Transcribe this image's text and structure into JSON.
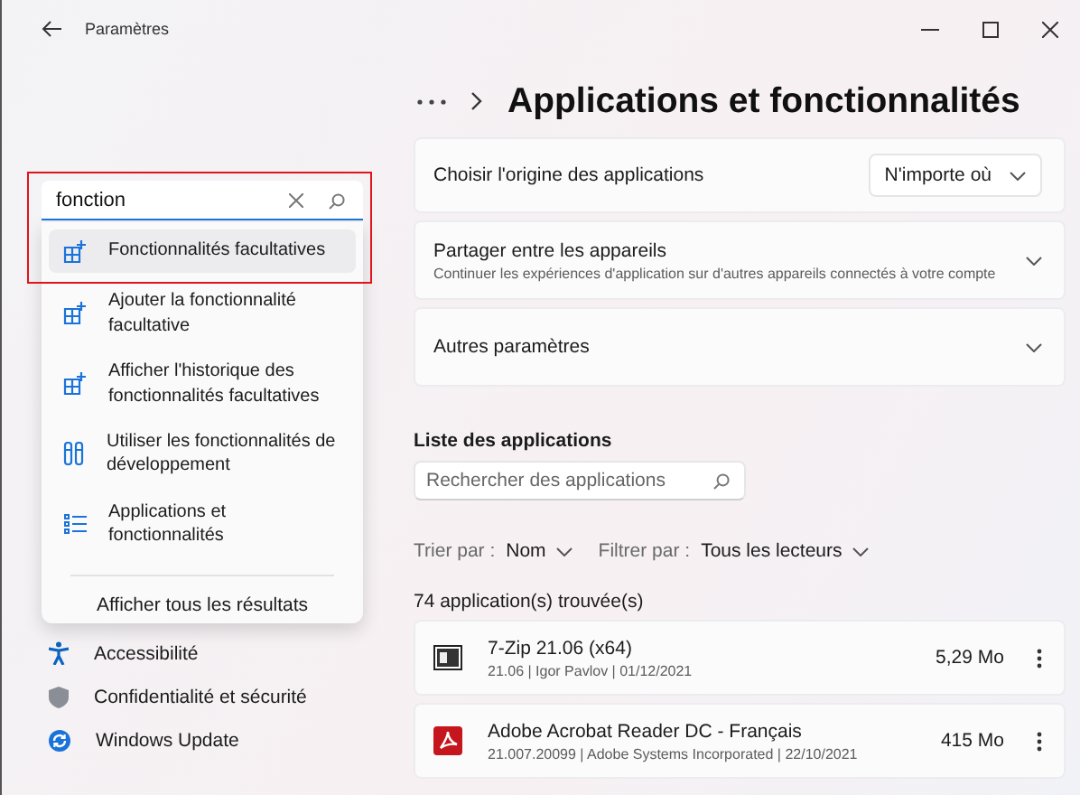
{
  "window": {
    "title": "Paramètres"
  },
  "search": {
    "value": "fonction",
    "highlighted": true
  },
  "suggestions": [
    {
      "label": "Fonctionnalités facultatives",
      "kind": "feature",
      "selected": true
    },
    {
      "label": "Ajouter la fonctionnalité facultative",
      "kind": "feature",
      "selected": false
    },
    {
      "label": "Afficher l'historique des fonctionnalités facultatives",
      "kind": "feature",
      "selected": false
    },
    {
      "label": "Utiliser les fonctionnalités de développement",
      "kind": "developer",
      "selected": false
    },
    {
      "label": "Applications et fonctionnalités",
      "kind": "list",
      "selected": false
    }
  ],
  "show_all": "Afficher tous les résultats",
  "nav": [
    {
      "label": "Accessibilité",
      "kind": "accessibility"
    },
    {
      "label": "Confidentialité et sécurité",
      "kind": "privacy"
    },
    {
      "label": "Windows Update",
      "kind": "update"
    }
  ],
  "page_title": "Applications et fonctionnalités",
  "settings": [
    {
      "kind": "dropdown",
      "label": "Choisir l'origine des applications",
      "value": "N'importe où"
    },
    {
      "kind": "expander",
      "label": "Partager entre les appareils",
      "description": "Continuer les expériences d'application sur d'autres appareils connectés à votre compte"
    },
    {
      "kind": "expander",
      "label": "Autres paramètres"
    }
  ],
  "app_list": {
    "heading": "Liste des applications",
    "search_placeholder": "Rechercher des applications",
    "sort": {
      "label": "Trier par :",
      "value": "Nom"
    },
    "filter": {
      "label": "Filtrer par :",
      "value": "Tous les lecteurs"
    },
    "count": "74 application(s) trouvée(s)",
    "apps": [
      {
        "kind": "archive",
        "name": "7-Zip 21.06 (x64)",
        "details": "21.06  |  Igor Pavlov  |  01/12/2021",
        "size": "5,29 Mo"
      },
      {
        "kind": "pdf",
        "name": "Adobe Acrobat Reader DC - Français",
        "details": "21.007.20099  |  Adobe Systems Incorporated  |  22/10/2021",
        "size": "415 Mo"
      }
    ]
  }
}
